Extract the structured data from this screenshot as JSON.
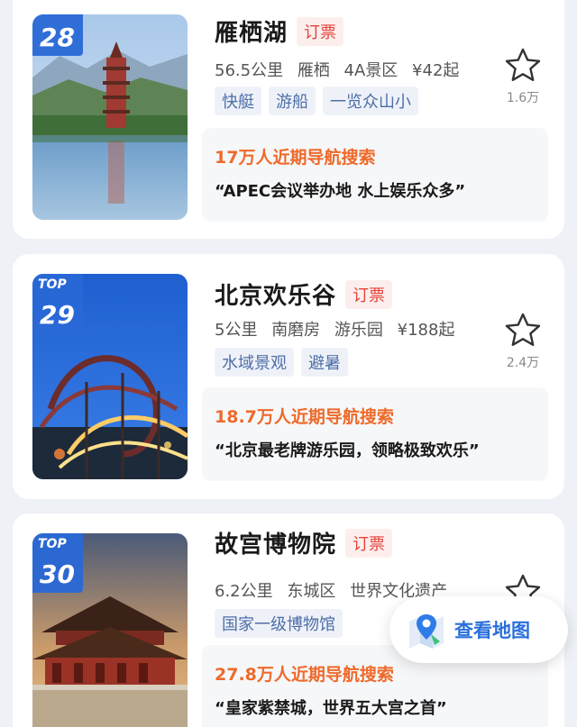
{
  "items": [
    {
      "rank": "28",
      "top_badge": "",
      "name": "雁栖湖",
      "book_label": "订票",
      "distance": "56.5公里",
      "area": "雁栖",
      "category": "4A景区",
      "price": "¥42起",
      "tags": [
        "快艇",
        "游船",
        "一览众山小"
      ],
      "fav_count": "1.6万",
      "search_stat": "17万人近期导航搜索",
      "quote": "“APEC会议举办地 水上娱乐众多”",
      "image": "pagoda-lake-image"
    },
    {
      "rank": "29",
      "top_badge": "TOP",
      "name": "北京欢乐谷",
      "book_label": "订票",
      "distance": "5公里",
      "area": "南磨房",
      "category": "游乐园",
      "price": "¥188起",
      "tags": [
        "水域景观",
        "避暑"
      ],
      "fav_count": "2.4万",
      "search_stat": "18.7万人近期导航搜索",
      "quote": "“北京最老牌游乐园，领略极致欢乐”",
      "image": "rollercoaster-image"
    },
    {
      "rank": "30",
      "top_badge": "TOP",
      "name": "故宫博物院",
      "book_label": "订票",
      "distance": "6.2公里",
      "area": "东城区",
      "category": "世界文化遗产",
      "price": "",
      "tags": [
        "国家一级博物馆"
      ],
      "fav_count": "",
      "search_stat": "27.8万人近期导航搜索",
      "quote": "“皇家紫禁城，世界五大宫之首”",
      "image": "palace-image"
    }
  ],
  "map_button": {
    "label": "查看地图",
    "icon": "map-pin-icon"
  },
  "colors": {
    "rank_badge": "#2968d6",
    "hot_text": "#ee6a2a",
    "book_text": "#e4433a",
    "map_label": "#2a6fdb"
  }
}
